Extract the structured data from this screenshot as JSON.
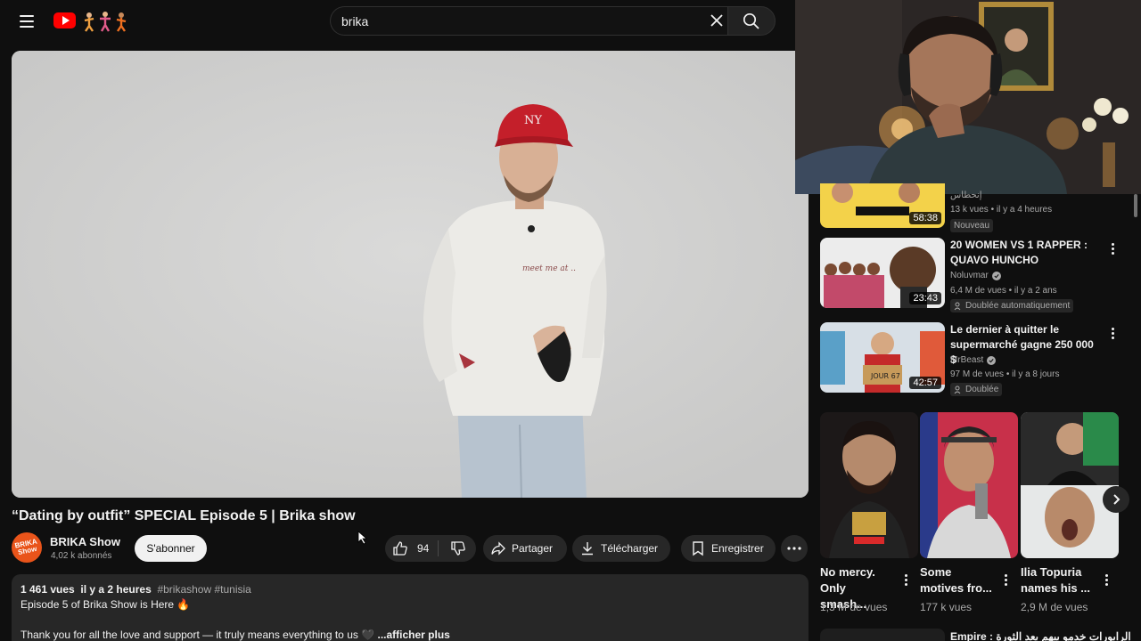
{
  "header": {
    "search_value": "brika",
    "menu_icon": "hamburger-menu-icon",
    "logo_icon": "youtube-logo-icon"
  },
  "video": {
    "title": "“Dating by outfit” SPECIAL Episode 5 | Brika show",
    "channel_name": "BRIKA Show",
    "channel_avatar_text": "BRIKA Show",
    "subscribers": "4,02 k abonnés",
    "subscribe_label": "S'abonner",
    "likes": "94",
    "share_label": "Partager",
    "download_label": "Télécharger",
    "save_label": "Enregistrer"
  },
  "description": {
    "views": "1 461 vues",
    "date": "il y a 2 heures",
    "tags": "#brikashow #tunisia",
    "line1": "Episode 5 of Brika Show is Here 🔥",
    "line2": "Thank you for all the love and support — it truly means everything to us 🖤",
    "more_label": "...afficher plus"
  },
  "sidebar": {
    "items": [
      {
        "duration": "58:38",
        "channel": "إنحطاس",
        "meta": "13 k vues • il y a 4 heures",
        "badge": "Nouveau"
      },
      {
        "title": "20 WOMEN VS 1 RAPPER : QUAVO HUNCHO",
        "duration": "23:43",
        "channel": "Noluvmar",
        "verified": true,
        "meta": "6,4 M de vues • il y a 2 ans",
        "badge": "Doublée automatiquement"
      },
      {
        "title": "Le dernier à quitter le supermarché gagne 250 000 $",
        "duration": "42:57",
        "channel": "MrBeast",
        "verified": true,
        "meta": "97 M de vues • il y a 8 jours",
        "badge": "Doublée"
      }
    ],
    "shorts": [
      {
        "title": "No mercy. Only smash...",
        "views": "1,3 M de vues"
      },
      {
        "title": "Some motives fro...",
        "views": "177 k vues"
      },
      {
        "title": "Ilia Topuria names his ...",
        "views": "2,9 M de vues"
      }
    ],
    "bottom_item_title": "Empire : الرابورات خدمو بيهم بعد الثورة"
  }
}
